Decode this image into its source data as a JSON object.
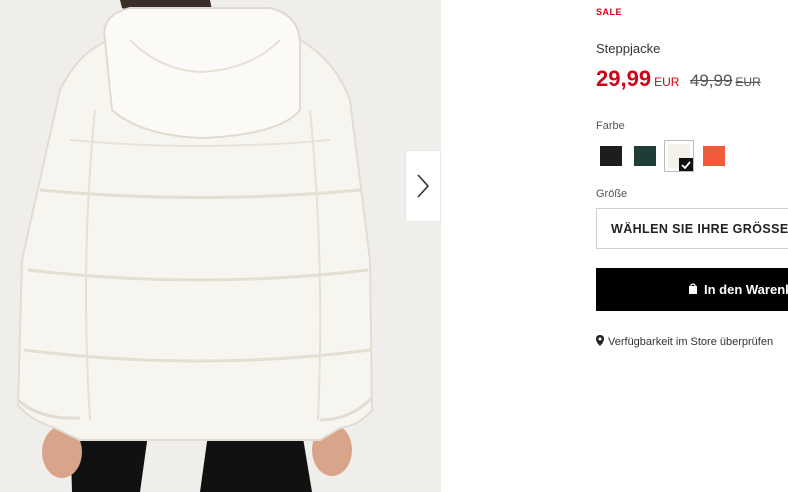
{
  "gallery": {
    "image_alt": "Steppjacke",
    "next_icon": "chevron-right-icon"
  },
  "product": {
    "badge": "SALE",
    "title": "Steppjacke",
    "price": {
      "current": "29,99",
      "current_currency": "EUR",
      "old": "49,99",
      "old_currency": "EUR"
    }
  },
  "color": {
    "label": "Farbe",
    "options": [
      {
        "name": "black",
        "hex": "#1d1d1d",
        "selected": false
      },
      {
        "name": "dark-green",
        "hex": "#1f3c36",
        "selected": false
      },
      {
        "name": "white",
        "hex": "#f4f1ea",
        "selected": true
      },
      {
        "name": "orange",
        "hex": "#f15a3a",
        "selected": false
      }
    ]
  },
  "size": {
    "label": "Größe",
    "placeholder": "WÄHLEN SIE IHRE GRÖSSE"
  },
  "cart": {
    "label": "In den Warenkorb",
    "icon": "shopping-bag-icon"
  },
  "store": {
    "label": "Verfügbarkeit im Store überprüfen",
    "icon": "map-pin-icon"
  },
  "colors": {
    "sale_red": "#d0021b",
    "button_black": "#000000"
  }
}
